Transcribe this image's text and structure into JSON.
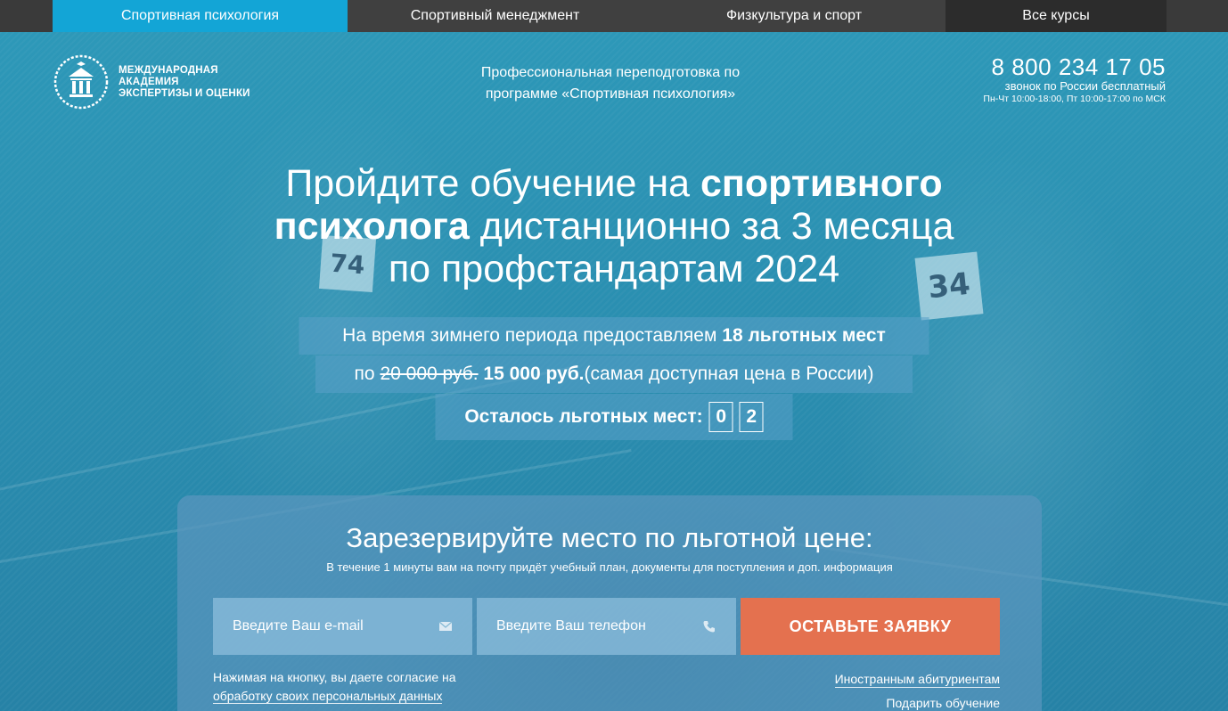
{
  "nav": {
    "items": [
      {
        "label": "Спортивная психология"
      },
      {
        "label": "Спортивный менеджмент"
      },
      {
        "label": "Физкультура и спорт"
      },
      {
        "label": "Все курсы"
      }
    ]
  },
  "header": {
    "logo_lines": [
      "МЕЖДУНАРОДНАЯ",
      "АКАДЕМИЯ",
      "ЭКСПЕРТИЗЫ И ОЦЕНКИ"
    ],
    "tagline_lines": [
      "Профессиональная переподготовка по",
      "программе «Спортивная психология»"
    ],
    "phone": "8 800 234 17 05",
    "phone_note": "звонок по России бесплатный",
    "hours": "Пн-Чт 10:00-18:00, Пт 10:00-17:00 по МСК"
  },
  "headline": {
    "part1": "Пройдите обучение на ",
    "bold1": "спортивного",
    "bold2": "психолога",
    "part2": " дистанционно за 3 месяца",
    "line3": "по профстандартам 2024"
  },
  "offer": {
    "row1_text": "На время зимнего периода предоставляем ",
    "row1_bold": "18 льготных мест",
    "row2_prefix": "по ",
    "old_price": "20 000 руб.",
    "new_price": "15 000 руб.",
    "row2_suffix": " (самая доступная цена в России)",
    "remaining_label": "Осталось льготных мест:",
    "remaining_digits": [
      "0",
      "2"
    ]
  },
  "form": {
    "title": "Зарезервируйте место по льготной цене:",
    "subtitle": "В течение 1 минуты вам на почту придёт учебный план, документы для поступления и доп. информация",
    "email_placeholder": "Введите Ваш e-mail",
    "phone_placeholder": "Введите Ваш телефон",
    "submit_label": "ОСТАВЬТЕ ЗАЯВКУ",
    "consent_line1": "Нажимая на кнопку, вы даете согласие на",
    "consent_link": "обработку своих персональных данных",
    "link_foreign": "Иностранным абитуриентам",
    "link_gift": "Подарить обучение"
  },
  "colors": {
    "nav_active": "#13a5d6",
    "nav_bg": "#404040",
    "submit": "#e4714f",
    "hero": "#2a8eb0"
  }
}
